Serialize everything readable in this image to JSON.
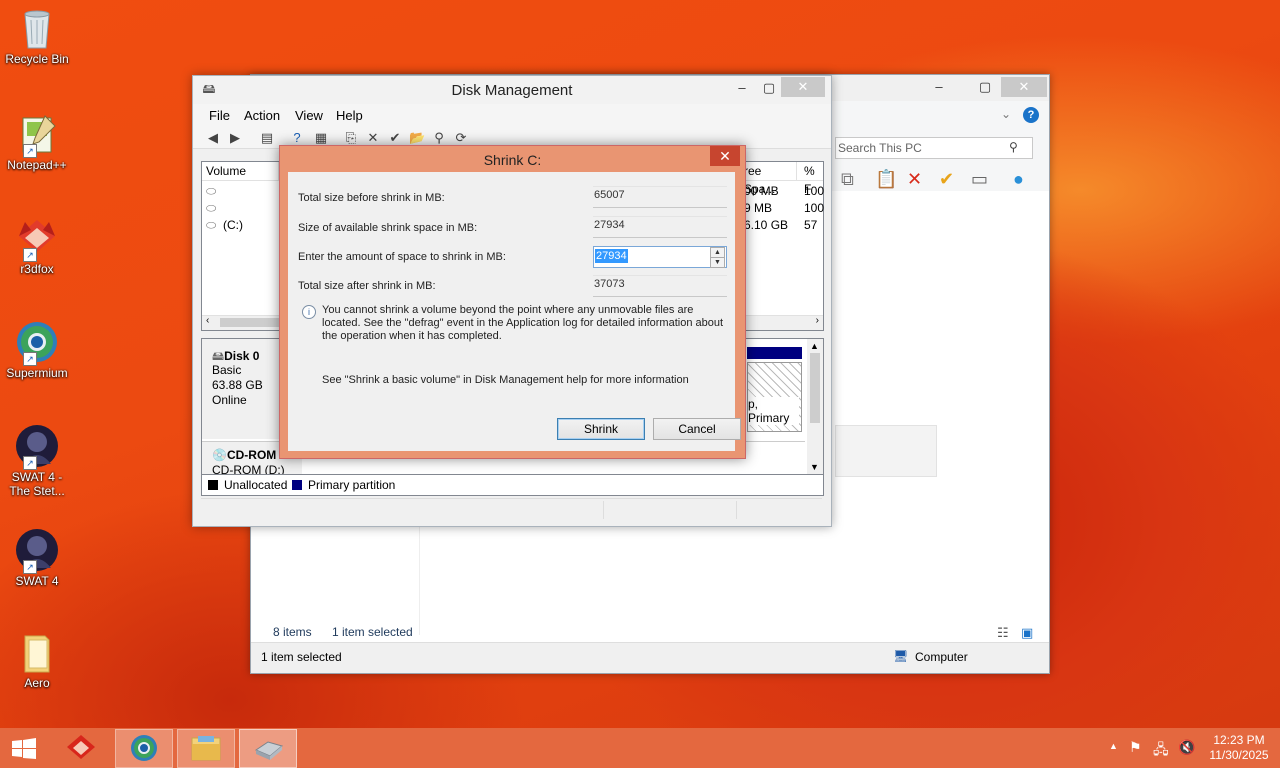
{
  "desktop": {
    "icons": [
      {
        "label": "Recycle Bin",
        "icon": "recycle-bin-icon"
      },
      {
        "label": "Notepad++",
        "icon": "notepad-plus-plus-icon"
      },
      {
        "label": "r3dfox",
        "icon": "r3dfox-icon"
      },
      {
        "label": "Supermium",
        "icon": "supermium-icon"
      },
      {
        "label": "SWAT 4 - The Stet...",
        "icon": "swat4-expansion-icon"
      },
      {
        "label": "SWAT 4",
        "icon": "swat4-icon"
      },
      {
        "label": "Aero",
        "icon": "folder-icon"
      }
    ]
  },
  "explorer": {
    "search_placeholder": "Search This PC",
    "items_count": "8 items",
    "selection": "1 item selected",
    "status_left": "1 item selected",
    "status_right": "Computer"
  },
  "disk_mgmt": {
    "title": "Disk Management",
    "menu": [
      "File",
      "Action",
      "View",
      "Help"
    ],
    "columns": [
      "Volume",
      "ree Spa...",
      "% F"
    ],
    "volumes": [
      {
        "name": "",
        "free": "00 MB",
        "pct": "100"
      },
      {
        "name": "",
        "free": "9 MB",
        "pct": "100"
      },
      {
        "name": "(C:)",
        "free": "6.10 GB",
        "pct": "57"
      }
    ],
    "disk0": {
      "name": "Disk 0",
      "type": "Basic",
      "size": "63.88 GB",
      "state": "Online",
      "partition_text": "p, Primary"
    },
    "cdrom": {
      "name": "CD-ROM",
      "drive": "CD-ROM (D:)"
    },
    "legend": [
      {
        "label": "Unallocated",
        "color": "#000000"
      },
      {
        "label": "Primary partition",
        "color": "#000080"
      }
    ]
  },
  "shrink_dialog": {
    "title": "Shrink C:",
    "fields": [
      {
        "label": "Total size before shrink in MB:",
        "value": "65007"
      },
      {
        "label": "Size of available shrink space in MB:",
        "value": "27934"
      },
      {
        "label": "Enter the amount of space to shrink in MB:",
        "value": "27934"
      },
      {
        "label": "Total size after shrink in MB:",
        "value": "37073"
      }
    ],
    "info_text": "You cannot shrink a volume beyond the point where any unmovable files are located. See the \"defrag\" event in the Application log for detailed information about the operation when it has completed.",
    "help_text": "See \"Shrink a basic volume\" in Disk Management help for more information",
    "shrink_label": "Shrink",
    "cancel_label": "Cancel"
  },
  "taskbar": {
    "time": "12:23 PM",
    "date": "11/30/2025"
  },
  "colors": {
    "taskbar": "#e4683f",
    "dialog_frame": "#e99572",
    "close_button": "#c7452f",
    "selection": "#3399ff"
  }
}
